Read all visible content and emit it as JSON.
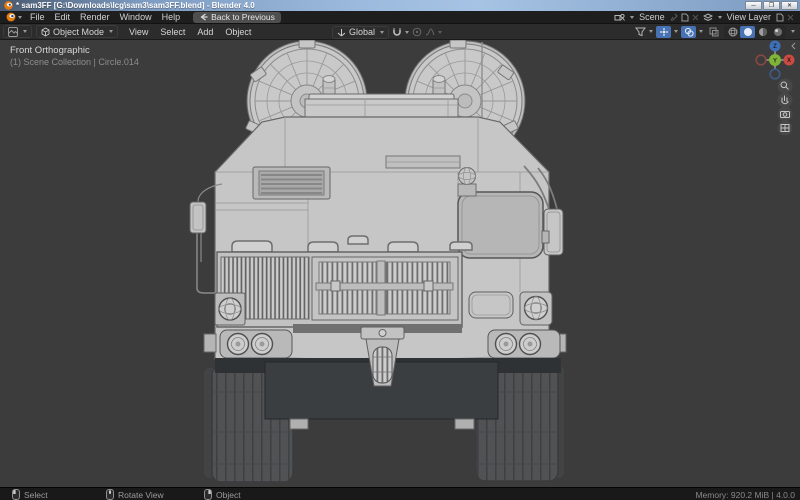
{
  "window": {
    "title": "* sam3FF [G:\\Downloads\\lcg\\sam3\\sam3FF.blend] - Blender 4.0",
    "controls": {
      "minimize": "─",
      "maximize": "❐",
      "close": "✕"
    }
  },
  "topbar": {
    "menus": [
      "File",
      "Edit",
      "Render",
      "Window",
      "Help"
    ],
    "back_button": "Back to Previous",
    "scene_selector": {
      "label": "Scene"
    },
    "view_layer_selector": {
      "label": "View Layer"
    }
  },
  "viewport_header": {
    "mode": "Object Mode",
    "menus": [
      "View",
      "Select",
      "Add",
      "Object"
    ],
    "orientation": "Global"
  },
  "viewport": {
    "view_label": "Front Orthographic",
    "breadcrumb": "(1) Scene Collection | Circle.014"
  },
  "gizmo": {
    "x": "X",
    "y": "Y",
    "z": "Z"
  },
  "status_bar": {
    "select": "Select",
    "rotate_view": "Rotate View",
    "object": "Object",
    "memory": "Memory: 920.2 MiB | 4.0.0"
  },
  "colors": {
    "accent_selected": "#4772b3",
    "axis_x": "#c84b44",
    "axis_y": "#7fb439",
    "axis_z": "#3f6fb5",
    "viewport_bg": "#3c3c3c",
    "model_gray": "#c6c6c6"
  }
}
